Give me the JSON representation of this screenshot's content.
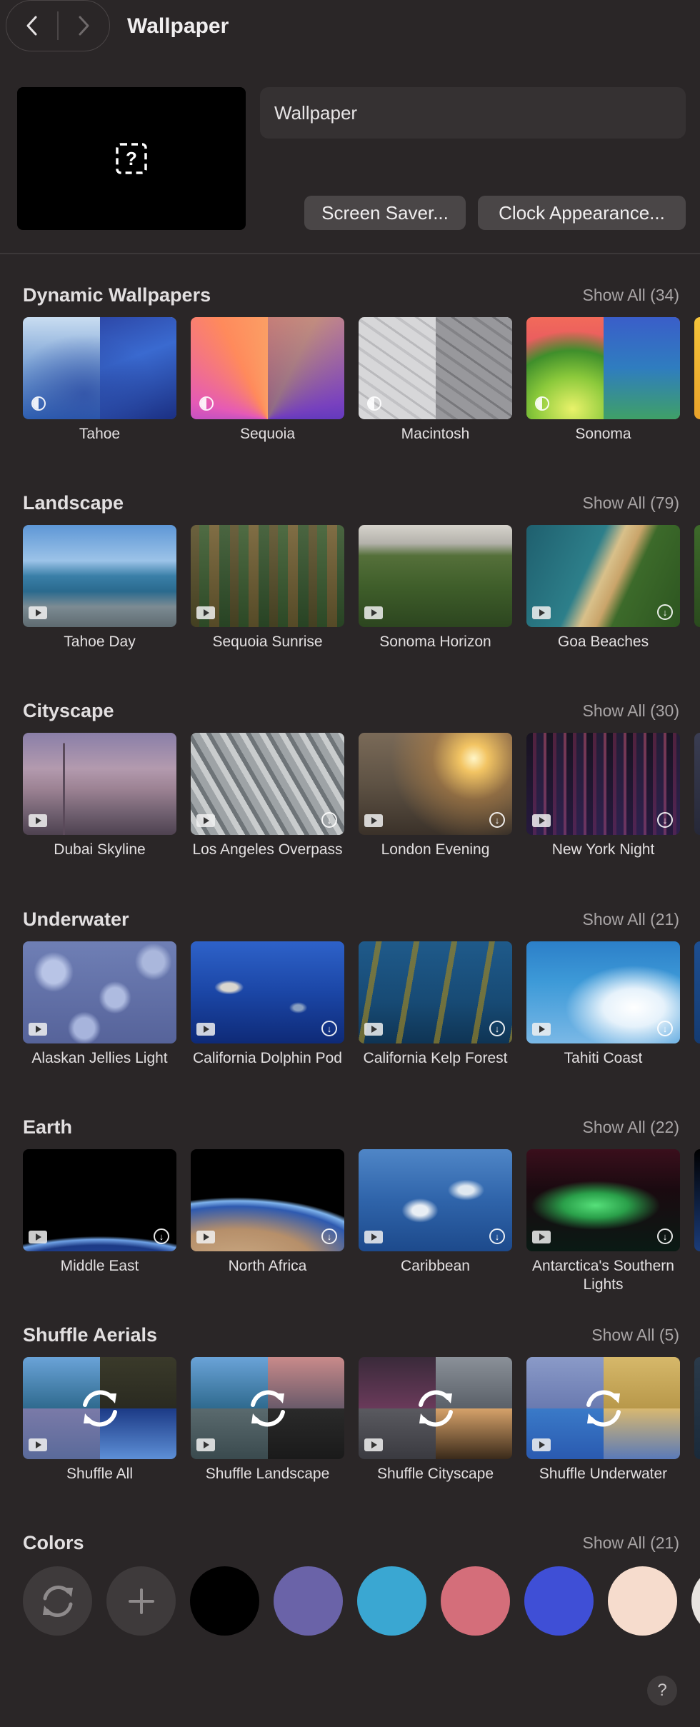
{
  "header": {
    "title": "Wallpaper",
    "back_icon": "chevron-left-icon",
    "forward_icon": "chevron-right-icon"
  },
  "current": {
    "preview_icon": "dashed-question-icon",
    "name": "Wallpaper",
    "screen_saver_label": "Screen Saver...",
    "clock_label": "Clock Appearance..."
  },
  "sections": [
    {
      "title": "Dynamic Wallpapers",
      "show_all": "Show All (34)",
      "items": [
        {
          "label": "Tahoe"
        },
        {
          "label": "Sequoia"
        },
        {
          "label": "Macintosh"
        },
        {
          "label": "Sonoma"
        }
      ]
    },
    {
      "title": "Landscape",
      "show_all": "Show All (79)",
      "items": [
        {
          "label": "Tahoe Day"
        },
        {
          "label": "Sequoia Sunrise"
        },
        {
          "label": "Sonoma Horizon"
        },
        {
          "label": "Goa Beaches"
        }
      ]
    },
    {
      "title": "Cityscape",
      "show_all": "Show All (30)",
      "items": [
        {
          "label": "Dubai Skyline"
        },
        {
          "label": "Los Angeles Overpass"
        },
        {
          "label": "London Evening"
        },
        {
          "label": "New York Night"
        }
      ]
    },
    {
      "title": "Underwater",
      "show_all": "Show All (21)",
      "items": [
        {
          "label": "Alaskan Jellies Light"
        },
        {
          "label": "California Dolphin Pod"
        },
        {
          "label": "California Kelp Forest"
        },
        {
          "label": "Tahiti Coast"
        }
      ]
    },
    {
      "title": "Earth",
      "show_all": "Show All (22)",
      "items": [
        {
          "label": "Middle East"
        },
        {
          "label": "North Africa"
        },
        {
          "label": "Caribbean"
        },
        {
          "label": "Antarctica's Southern Lights"
        }
      ]
    },
    {
      "title": "Shuffle Aerials",
      "show_all": "Show All (5)",
      "items": [
        {
          "label": "Shuffle All"
        },
        {
          "label": "Shuffle Landscape"
        },
        {
          "label": "Shuffle Cityscape"
        },
        {
          "label": "Shuffle Underwater"
        }
      ]
    }
  ],
  "colors": {
    "title": "Colors",
    "show_all": "Show All (21)",
    "tool_icons": [
      "rotate-icon",
      "plus-icon"
    ],
    "swatches": [
      "#000000",
      "#6a63a8",
      "#3aa7d2",
      "#d46e7a",
      "#3f4fd6",
      "#f6dccd"
    ]
  },
  "help_label": "?"
}
